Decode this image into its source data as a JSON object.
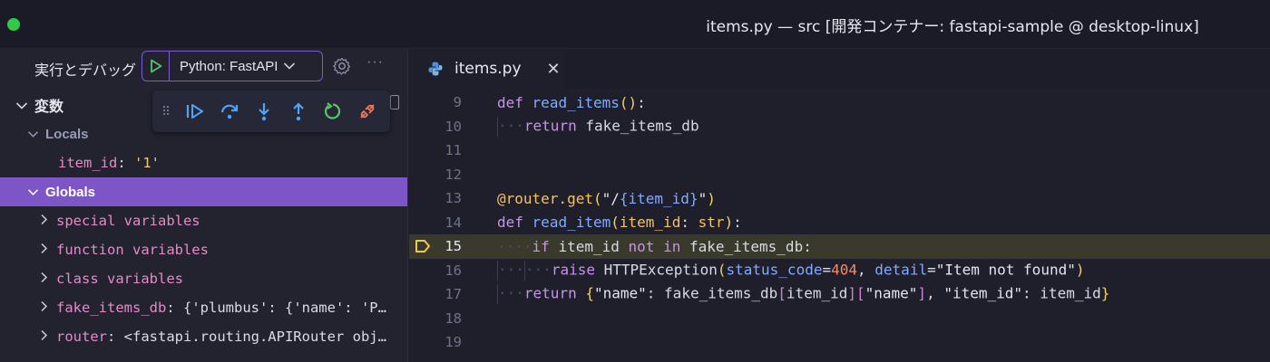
{
  "window": {
    "title": "items.py — src [開発コンテナー: fastapi-sample @ desktop-linux]"
  },
  "sidebar": {
    "title": "実行とデバッグ",
    "launch_config": "Python: FastAPI",
    "more": "···",
    "variables_section": "変数",
    "scopes": [
      {
        "label": "Locals"
      },
      {
        "label": "Globals"
      }
    ],
    "locals": [
      {
        "name": "item_id",
        "value": "'1'"
      }
    ],
    "globals": [
      {
        "label": "special variables"
      },
      {
        "label": "function variables"
      },
      {
        "label": "class variables"
      },
      {
        "name": "fake_items_db",
        "value": "{'plumbus': {'name': 'P…"
      },
      {
        "name": "router",
        "value": "<fastapi.routing.APIRouter obj…"
      }
    ]
  },
  "debug_toolbar": {
    "buttons": [
      "continue",
      "step-over",
      "step-into",
      "step-out",
      "restart",
      "disconnect"
    ]
  },
  "editor": {
    "tab": {
      "label": "items.py",
      "close": "✕"
    },
    "current_line": 15,
    "line_numbers": [
      "9",
      "10",
      "11",
      "12",
      "13",
      "14",
      "15",
      "16",
      "17",
      "18",
      "19"
    ],
    "code": {
      "l9_def": "def",
      "l9_fn": "read_items",
      "l10_return": "return",
      "l10_id": "fake_items_db",
      "l13_dec": "@router.get",
      "l13_path_a": "\"/",
      "l13_path_b": "{item_id}",
      "l13_path_c": "\"",
      "l14_def": "def",
      "l14_fn": "read_item",
      "l14_param": "item_id",
      "l14_type": "str",
      "l15_if": "if",
      "l15_id": "item_id",
      "l15_not": "not",
      "l15_in": "in",
      "l15_db": "fake_items_db",
      "l16_raise": "raise",
      "l16_exc": "HTTPException",
      "l16_k1": "status_code",
      "l16_v1": "404",
      "l16_k2": "detail",
      "l16_v2": "\"Item not found\"",
      "l17_return": "return",
      "l17_k1": "\"name\"",
      "l17_db": "fake_items_db",
      "l17_idx1": "item_id",
      "l17_idx2": "\"name\"",
      "l17_k2": "\"item_id\"",
      "l17_v2": "item_id"
    }
  },
  "colors": {
    "accent": "#7e55c6",
    "current_line": "#393a2c",
    "breakpoint_arrow": "#f3c94a"
  }
}
